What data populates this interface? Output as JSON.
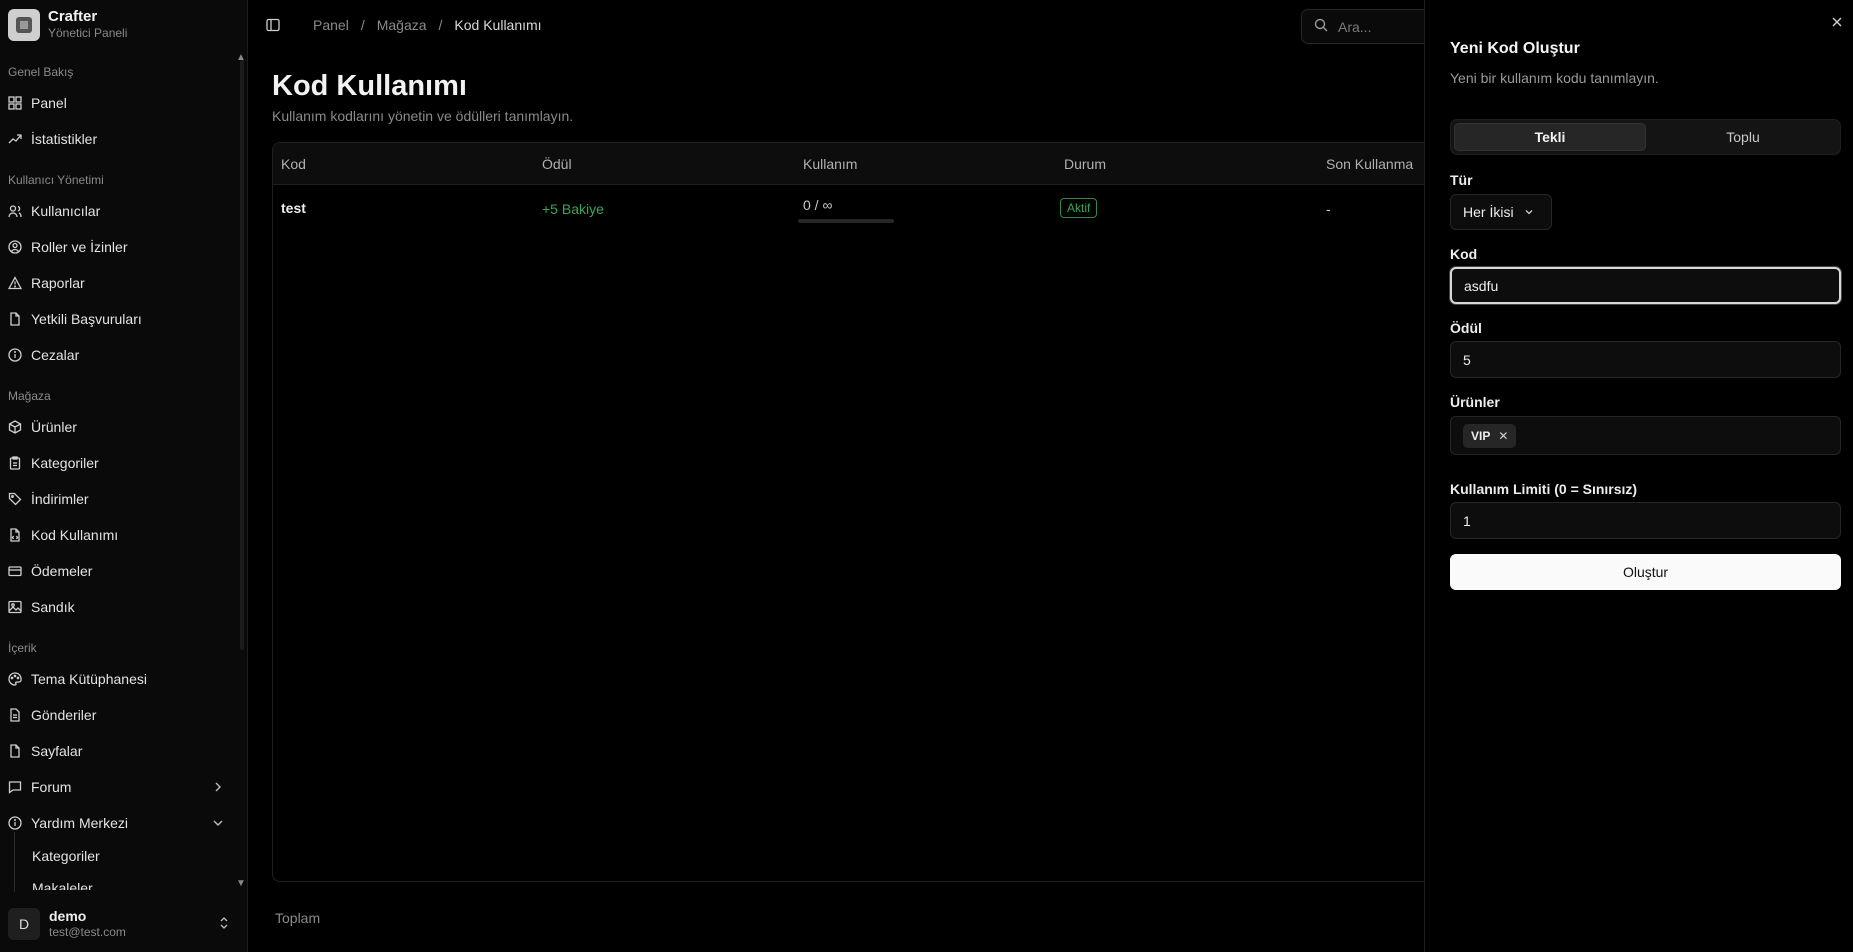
{
  "brand": {
    "name": "Crafter",
    "subtitle": "Yönetici Paneli"
  },
  "sidebar": {
    "groups": [
      {
        "title": "Genel Bakış",
        "items": [
          {
            "label": "Panel",
            "icon": "grid-icon"
          },
          {
            "label": "İstatistikler",
            "icon": "trend-icon"
          }
        ]
      },
      {
        "title": "Kullanıcı Yönetimi",
        "items": [
          {
            "label": "Kullanıcılar",
            "icon": "users-icon"
          },
          {
            "label": "Roller ve İzinler",
            "icon": "user-circle-icon"
          },
          {
            "label": "Raporlar",
            "icon": "warning-icon"
          },
          {
            "label": "Yetkili Başvuruları",
            "icon": "file-icon"
          },
          {
            "label": "Cezalar",
            "icon": "info-circle-icon"
          }
        ]
      },
      {
        "title": "Mağaza",
        "items": [
          {
            "label": "Ürünler",
            "icon": "box-icon"
          },
          {
            "label": "Kategoriler",
            "icon": "clipboard-icon"
          },
          {
            "label": "İndirimler",
            "icon": "tag-icon"
          },
          {
            "label": "Kod Kullanımı",
            "icon": "file-code-icon"
          },
          {
            "label": "Ödemeler",
            "icon": "card-icon"
          },
          {
            "label": "Sandık",
            "icon": "image-icon"
          }
        ]
      },
      {
        "title": "İçerik",
        "items": [
          {
            "label": "Tema Kütüphanesi",
            "icon": "palette-icon"
          },
          {
            "label": "Gönderiler",
            "icon": "file-text-icon"
          },
          {
            "label": "Sayfalar",
            "icon": "page-icon"
          },
          {
            "label": "Forum",
            "icon": "message-icon"
          },
          {
            "label": "Yardım Merkezi",
            "icon": "info-circle-icon"
          }
        ]
      }
    ],
    "help_sub": [
      "Kategoriler",
      "Makaleler"
    ]
  },
  "user": {
    "initial": "D",
    "name": "demo",
    "email": "test@test.com"
  },
  "breadcrumb": {
    "items": [
      "Panel",
      "Mağaza"
    ],
    "current": "Kod Kullanımı"
  },
  "search": {
    "placeholder": "Ara..."
  },
  "page": {
    "title": "Kod Kullanımı",
    "subtitle": "Kullanım kodlarını yönetin ve ödülleri tanımlayın."
  },
  "table": {
    "columns": [
      "Kod",
      "Ödül",
      "Kullanım",
      "Durum",
      "Son Kullanma"
    ],
    "rows": [
      {
        "code": "test",
        "reward": "+5 Bakiye",
        "usage": "0 / ∞",
        "status": "Aktif",
        "expiry": "-"
      }
    ]
  },
  "footer": {
    "total_label": "Toplam"
  },
  "sheet": {
    "title": "Yeni Kod Oluştur",
    "description": "Yeni bir kullanım kodu tanımlayın.",
    "tabs": [
      "Tekli",
      "Toplu"
    ],
    "type_label": "Tür",
    "type_value": "Her İkisi",
    "code_label": "Kod",
    "code_value": "asdfu",
    "reward_label": "Ödül",
    "reward_value": "5",
    "products_label": "Ürünler",
    "products": [
      "VIP"
    ],
    "limit_label": "Kullanım Limiti (0 = Sınırsız)",
    "limit_value": "1",
    "submit_label": "Oluştur"
  }
}
